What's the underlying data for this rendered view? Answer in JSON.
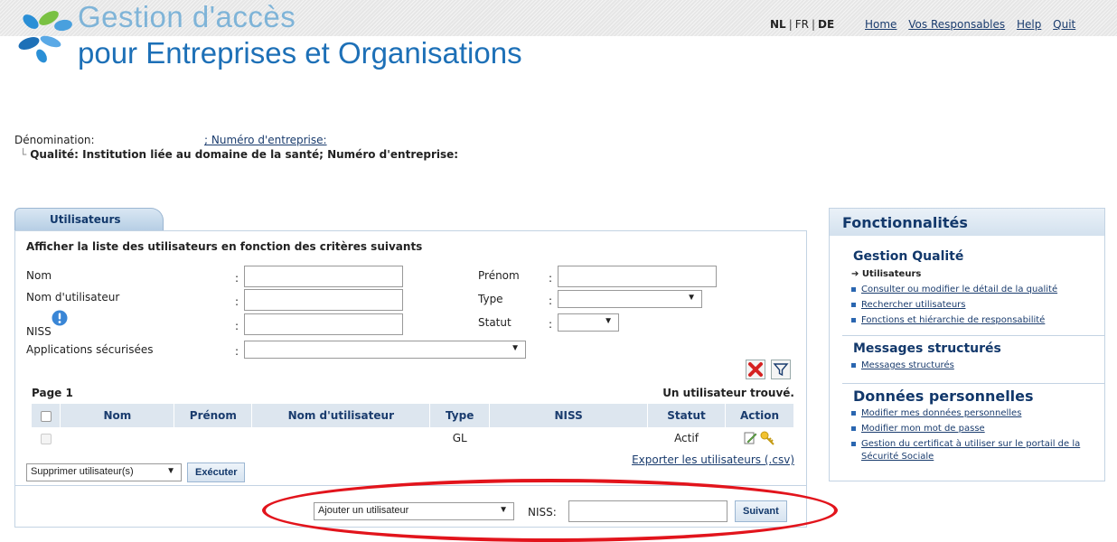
{
  "header": {
    "brand_line1": "Gestion d'accès",
    "brand_line2": "pour Entreprises et Organisations",
    "languages": [
      "NL",
      "FR",
      "DE"
    ],
    "nav": [
      "Home",
      "Vos Responsables",
      "Help",
      "Quit"
    ]
  },
  "org": {
    "denomination_label": "Dénomination:",
    "denomination_link": "; Numéro d'entreprise:",
    "quality_line": "Qualité: Institution liée au domaine de la santé; Numéro d'entreprise:"
  },
  "users": {
    "tab_label": "Utilisateurs",
    "filter_title": "Afficher la liste des utilisateurs en fonction des critères suivants",
    "fields": {
      "nom": "Nom",
      "prenom": "Prénom",
      "nom_utilisateur": "Nom d'utilisateur",
      "type": "Type",
      "niss": "NISS",
      "statut": "Statut",
      "applications": "Applications sécurisées"
    },
    "page_label": "Page 1",
    "found_label": "Un utilisateur trouvé.",
    "columns": [
      "Nom",
      "Prénom",
      "Nom d'utilisateur",
      "Type",
      "NISS",
      "Statut",
      "Action"
    ],
    "rows": [
      {
        "nom": "",
        "prenom": "",
        "nom_utilisateur": "",
        "type": "GL",
        "niss": "",
        "statut": "Actif"
      }
    ],
    "export_link": "Exporter les utilisateurs (.csv)",
    "bulk_action_selected": "Supprimer utilisateur(s)",
    "execute_label": "Exécuter",
    "add_action_selected": "Ajouter un utilisateur",
    "niss_label": "NISS:",
    "next_label": "Suivant"
  },
  "sidebar": {
    "title": "Fonctionnalités",
    "sections": [
      {
        "title": "Gestion Qualité",
        "items": [
          "Utilisateurs",
          "Consulter ou modifier le détail de la qualité",
          "Rechercher utilisateurs",
          "Fonctions et hiérarchie de responsabilité"
        ]
      },
      {
        "title": "Messages structurés",
        "items": [
          "Messages structurés"
        ]
      },
      {
        "title": "Données personnelles",
        "items": [
          "Modifier mes données personnelles",
          "Modifier mon mot de passe",
          "Gestion du certificat à utiliser sur le portail de la",
          "Sécurité Sociale"
        ]
      }
    ]
  },
  "colors": {
    "accent": "#1d70b7",
    "accent_light": "#7fb4d8",
    "highlight_ring": "#e2141c"
  }
}
